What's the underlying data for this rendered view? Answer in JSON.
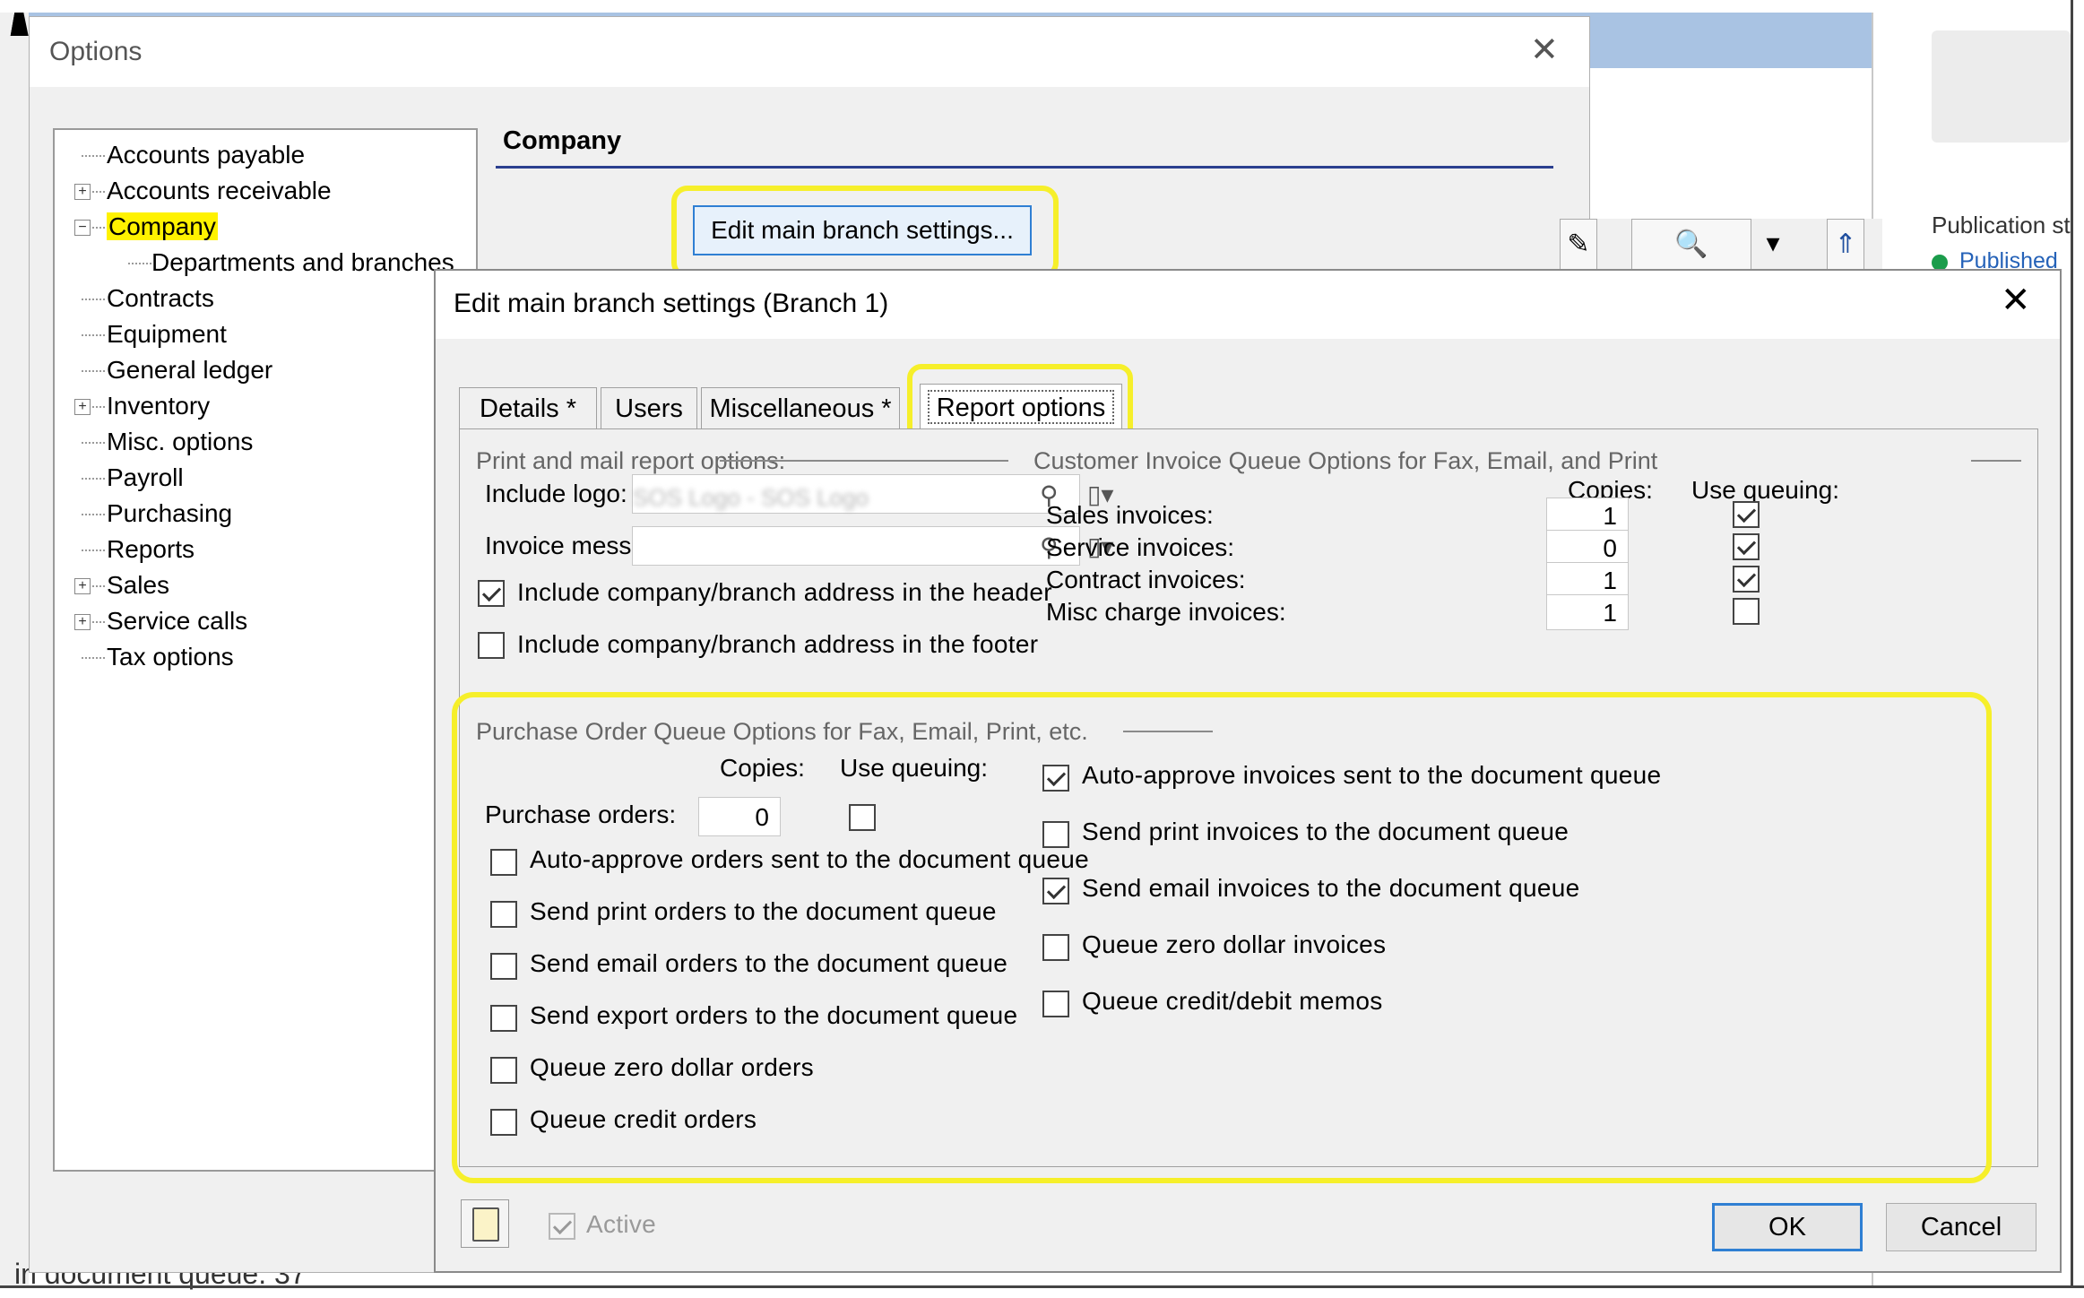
{
  "background": {
    "publication_label": "Publication st",
    "publication_status": "Published",
    "bottom_text": "in document queue. 37"
  },
  "options_window": {
    "title": "Options",
    "tree": [
      {
        "label": "Accounts payable",
        "expandable": false
      },
      {
        "label": "Accounts receivable",
        "expandable": true
      },
      {
        "label": "Company",
        "expandable": true,
        "expanded": true,
        "selected": true
      },
      {
        "label": "Departments and branches",
        "child": true
      },
      {
        "label": "Contracts",
        "expandable": false
      },
      {
        "label": "Equipment",
        "expandable": false
      },
      {
        "label": "General ledger",
        "expandable": false
      },
      {
        "label": "Inventory",
        "expandable": true
      },
      {
        "label": "Misc. options",
        "expandable": false
      },
      {
        "label": "Payroll",
        "expandable": false
      },
      {
        "label": "Purchasing",
        "expandable": false
      },
      {
        "label": "Reports",
        "expandable": false
      },
      {
        "label": "Sales",
        "expandable": true
      },
      {
        "label": "Service calls",
        "expandable": true
      },
      {
        "label": "Tax options",
        "expandable": false
      }
    ],
    "section_header": "Company",
    "edit_main_button": "Edit main branch settings..."
  },
  "dialog": {
    "title": "Edit main branch settings (Branch 1)",
    "tabs": [
      "Details *",
      "Users",
      "Miscellaneous *",
      "Report options"
    ],
    "active_tab": "Report options",
    "print_mail": {
      "group_title": "Print and mail report options:",
      "include_logo_label": "Include logo:",
      "include_logo_value": "SOS Logo - SOS Logo",
      "invoice_message_label": "Invoice message:",
      "header_address_label": "Include company/branch address in the header",
      "header_address_checked": true,
      "footer_address_label": "Include company/branch address in the footer",
      "footer_address_checked": false
    },
    "customer_invoice_queue": {
      "group_title": "Customer Invoice Queue Options for Fax, Email, and Print",
      "copies_header": "Copies:",
      "use_queuing_header": "Use queuing:",
      "rows": [
        {
          "label": "Sales invoices:",
          "copies": "1",
          "use_queuing": true
        },
        {
          "label": "Service invoices:",
          "copies": "0",
          "use_queuing": true
        },
        {
          "label": "Contract invoices:",
          "copies": "1",
          "use_queuing": true
        },
        {
          "label": "Misc charge invoices:",
          "copies": "1",
          "use_queuing": false
        }
      ],
      "options": [
        {
          "label": "Auto-approve invoices sent to the document queue",
          "checked": true
        },
        {
          "label": "Send print invoices to the document queue",
          "checked": false
        },
        {
          "label": "Send email invoices to the document queue",
          "checked": true
        },
        {
          "label": "Queue zero dollar invoices",
          "checked": false
        },
        {
          "label": "Queue credit/debit memos",
          "checked": false
        }
      ]
    },
    "purchase_order_queue": {
      "group_title": "Purchase Order Queue Options for Fax, Email, Print, etc.",
      "copies_header": "Copies:",
      "use_queuing_header": "Use queuing:",
      "purchase_orders_label": "Purchase orders:",
      "purchase_orders_copies": "0",
      "purchase_orders_queuing": false,
      "options": [
        {
          "label": "Auto-approve orders sent to the document queue",
          "checked": false
        },
        {
          "label": "Send print orders to the document queue",
          "checked": false
        },
        {
          "label": "Send email orders to the document queue",
          "checked": false
        },
        {
          "label": "Send export orders to the document queue",
          "checked": false
        },
        {
          "label": "Queue zero dollar orders",
          "checked": false
        },
        {
          "label": "Queue credit orders",
          "checked": false
        }
      ]
    },
    "active_label": "Active",
    "active_checked": true,
    "ok_label": "OK",
    "cancel_label": "Cancel"
  },
  "colors": {
    "highlight": "#f6ef2a",
    "accent_blue": "#2f7fd3",
    "section_rule": "#2b3f8f"
  }
}
